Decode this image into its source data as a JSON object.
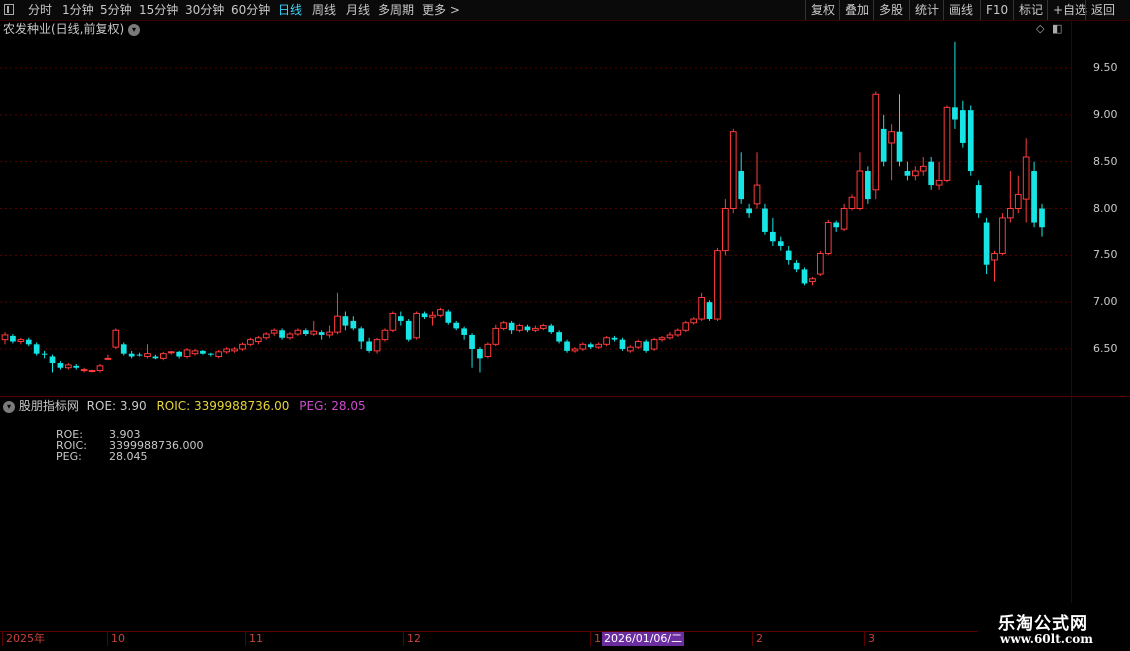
{
  "toolbar": {
    "items": [
      "分时",
      "1分钟",
      "5分钟",
      "15分钟",
      "30分钟",
      "60分钟",
      "日线",
      "周线",
      "月线",
      "多周期",
      "更多 >"
    ],
    "active": "日线",
    "right_items": [
      "复权",
      "叠加",
      "多股",
      "统计",
      "画线",
      "F10",
      "标记",
      "+自选",
      "返回"
    ]
  },
  "stock": {
    "title": "农发种业(日线,前复权)"
  },
  "yaxis": {
    "labels": [
      "9.50",
      "9.00",
      "8.50",
      "8.00",
      "7.50",
      "7.00",
      "6.50"
    ]
  },
  "indicator": {
    "name": "股朋指标网",
    "roe_text": "ROE: 3.90",
    "roic_text": "ROIC: 3399988736.00",
    "peg_text": "PEG: 28.05",
    "rows": [
      {
        "k": "ROE:",
        "v": "3.903"
      },
      {
        "k": "ROIC:",
        "v": "3399988736.000"
      },
      {
        "k": "PEG:",
        "v": "28.045"
      }
    ]
  },
  "dateaxis": {
    "labels": [
      "2025年",
      "10",
      "11",
      "12",
      "1",
      "2",
      "3"
    ],
    "highlight": "2026/01/06/二"
  },
  "watermark": {
    "line1": "乐淘公式网",
    "line2": "www.60lt.com"
  },
  "colors": {
    "up": "#ff3b3b",
    "down": "#17e5e5",
    "grid": "#5a0000",
    "roic": "#e8d63a",
    "peg": "#d04bd0"
  },
  "candles": [
    [
      6.6,
      6.65,
      6.55,
      6.68
    ],
    [
      6.64,
      6.58,
      6.56,
      6.66
    ],
    [
      6.58,
      6.6,
      6.55,
      6.62
    ],
    [
      6.6,
      6.55,
      6.53,
      6.62
    ],
    [
      6.55,
      6.45,
      6.43,
      6.57
    ],
    [
      6.45,
      6.44,
      6.4,
      6.48
    ],
    [
      6.42,
      6.35,
      6.25,
      6.44
    ],
    [
      6.35,
      6.3,
      6.28,
      6.37
    ],
    [
      6.3,
      6.33,
      6.28,
      6.35
    ],
    [
      6.32,
      6.3,
      6.28,
      6.34
    ],
    [
      6.28,
      6.28,
      6.25,
      6.3
    ],
    [
      6.26,
      6.27,
      6.25,
      6.28
    ],
    [
      6.27,
      6.32,
      6.25,
      6.34
    ],
    [
      6.4,
      6.4,
      6.38,
      6.44
    ],
    [
      6.52,
      6.7,
      6.5,
      6.72
    ],
    [
      6.55,
      6.45,
      6.43,
      6.57
    ],
    [
      6.45,
      6.42,
      6.4,
      6.48
    ],
    [
      6.44,
      6.43,
      6.42,
      6.46
    ],
    [
      6.42,
      6.45,
      6.4,
      6.55
    ],
    [
      6.42,
      6.4,
      6.39,
      6.44
    ],
    [
      6.4,
      6.45,
      6.38,
      6.47
    ],
    [
      6.46,
      6.47,
      6.44,
      6.48
    ],
    [
      6.47,
      6.42,
      6.4,
      6.48
    ],
    [
      6.42,
      6.49,
      6.4,
      6.51
    ],
    [
      6.45,
      6.48,
      6.43,
      6.5
    ],
    [
      6.48,
      6.45,
      6.44,
      6.49
    ],
    [
      6.45,
      6.44,
      6.42,
      6.46
    ],
    [
      6.42,
      6.47,
      6.4,
      6.49
    ],
    [
      6.47,
      6.5,
      6.45,
      6.52
    ],
    [
      6.48,
      6.5,
      6.46,
      6.52
    ],
    [
      6.5,
      6.55,
      6.48,
      6.57
    ],
    [
      6.55,
      6.6,
      6.53,
      6.62
    ],
    [
      6.58,
      6.62,
      6.55,
      6.64
    ],
    [
      6.62,
      6.66,
      6.6,
      6.68
    ],
    [
      6.67,
      6.7,
      6.64,
      6.72
    ],
    [
      6.7,
      6.62,
      6.6,
      6.72
    ],
    [
      6.62,
      6.66,
      6.6,
      6.68
    ],
    [
      6.66,
      6.7,
      6.64,
      6.72
    ],
    [
      6.7,
      6.66,
      6.64,
      6.72
    ],
    [
      6.66,
      6.69,
      6.64,
      6.8
    ],
    [
      6.68,
      6.65,
      6.6,
      6.7
    ],
    [
      6.65,
      6.68,
      6.62,
      6.75
    ],
    [
      6.68,
      6.85,
      6.66,
      7.1
    ],
    [
      6.85,
      6.75,
      6.7,
      6.9
    ],
    [
      6.8,
      6.72,
      6.7,
      6.85
    ],
    [
      6.72,
      6.58,
      6.5,
      6.74
    ],
    [
      6.58,
      6.48,
      6.46,
      6.62
    ],
    [
      6.48,
      6.6,
      6.45,
      6.62
    ],
    [
      6.6,
      6.7,
      6.58,
      6.72
    ],
    [
      6.7,
      6.88,
      6.68,
      6.9
    ],
    [
      6.85,
      6.8,
      6.75,
      6.9
    ],
    [
      6.8,
      6.6,
      6.58,
      6.82
    ],
    [
      6.62,
      6.88,
      6.6,
      6.9
    ],
    [
      6.88,
      6.84,
      6.82,
      6.9
    ],
    [
      6.84,
      6.86,
      6.75,
      6.9
    ],
    [
      6.86,
      6.92,
      6.84,
      6.94
    ],
    [
      6.9,
      6.78,
      6.76,
      6.92
    ],
    [
      6.78,
      6.72,
      6.7,
      6.8
    ],
    [
      6.72,
      6.65,
      6.6,
      6.74
    ],
    [
      6.65,
      6.5,
      6.3,
      6.67
    ],
    [
      6.5,
      6.4,
      6.25,
      6.52
    ],
    [
      6.42,
      6.55,
      6.4,
      6.57
    ],
    [
      6.55,
      6.72,
      6.53,
      6.76
    ],
    [
      6.72,
      6.78,
      6.7,
      6.8
    ],
    [
      6.78,
      6.7,
      6.66,
      6.8
    ],
    [
      6.7,
      6.75,
      6.68,
      6.77
    ],
    [
      6.74,
      6.7,
      6.68,
      6.76
    ],
    [
      6.7,
      6.72,
      6.68,
      6.75
    ],
    [
      6.72,
      6.75,
      6.7,
      6.77
    ],
    [
      6.75,
      6.68,
      6.66,
      6.77
    ],
    [
      6.68,
      6.58,
      6.56,
      6.7
    ],
    [
      6.58,
      6.48,
      6.46,
      6.6
    ],
    [
      6.48,
      6.5,
      6.46,
      6.52
    ],
    [
      6.5,
      6.55,
      6.48,
      6.57
    ],
    [
      6.55,
      6.52,
      6.5,
      6.57
    ],
    [
      6.52,
      6.55,
      6.5,
      6.57
    ],
    [
      6.55,
      6.62,
      6.53,
      6.64
    ],
    [
      6.62,
      6.6,
      6.58,
      6.64
    ],
    [
      6.6,
      6.5,
      6.48,
      6.62
    ],
    [
      6.48,
      6.52,
      6.46,
      6.54
    ],
    [
      6.52,
      6.58,
      6.5,
      6.6
    ],
    [
      6.58,
      6.48,
      6.46,
      6.6
    ],
    [
      6.5,
      6.6,
      6.48,
      6.62
    ],
    [
      6.6,
      6.62,
      6.58,
      6.64
    ],
    [
      6.62,
      6.65,
      6.6,
      6.68
    ],
    [
      6.65,
      6.7,
      6.63,
      6.72
    ],
    [
      6.7,
      6.78,
      6.68,
      6.8
    ],
    [
      6.78,
      6.82,
      6.76,
      6.84
    ],
    [
      6.82,
      7.05,
      6.8,
      7.1
    ],
    [
      7.0,
      6.82,
      6.8,
      7.02
    ],
    [
      6.82,
      7.55,
      6.8,
      7.58
    ],
    [
      7.55,
      8.0,
      7.5,
      8.1
    ],
    [
      8.0,
      8.82,
      7.95,
      8.85
    ],
    [
      8.4,
      8.1,
      8.05,
      8.6
    ],
    [
      8.0,
      7.95,
      7.9,
      8.05
    ],
    [
      8.05,
      8.25,
      8.0,
      8.6
    ],
    [
      8.0,
      7.75,
      7.72,
      8.05
    ],
    [
      7.75,
      7.65,
      7.6,
      7.9
    ],
    [
      7.65,
      7.6,
      7.55,
      7.7
    ],
    [
      7.55,
      7.45,
      7.4,
      7.6
    ],
    [
      7.42,
      7.35,
      7.32,
      7.45
    ],
    [
      7.35,
      7.2,
      7.18,
      7.37
    ],
    [
      7.22,
      7.25,
      7.18,
      7.27
    ],
    [
      7.3,
      7.52,
      7.28,
      7.55
    ],
    [
      7.52,
      7.85,
      7.5,
      7.88
    ],
    [
      7.85,
      7.8,
      7.75,
      7.87
    ],
    [
      7.78,
      8.0,
      7.76,
      8.05
    ],
    [
      8.0,
      8.12,
      7.98,
      8.15
    ],
    [
      8.0,
      8.4,
      7.98,
      8.6
    ],
    [
      8.4,
      8.1,
      8.05,
      8.45
    ],
    [
      8.2,
      9.22,
      8.1,
      9.25
    ],
    [
      8.85,
      8.5,
      8.45,
      9.0
    ],
    [
      8.7,
      8.82,
      8.3,
      8.9
    ],
    [
      8.82,
      8.5,
      8.45,
      9.22
    ],
    [
      8.4,
      8.35,
      8.3,
      8.5
    ],
    [
      8.35,
      8.4,
      8.3,
      8.45
    ],
    [
      8.4,
      8.45,
      8.35,
      8.55
    ],
    [
      8.5,
      8.25,
      8.2,
      8.55
    ],
    [
      8.25,
      8.3,
      8.2,
      8.5
    ],
    [
      8.3,
      9.08,
      8.28,
      9.1
    ],
    [
      9.08,
      8.95,
      8.85,
      9.78
    ],
    [
      9.05,
      8.7,
      8.65,
      9.15
    ],
    [
      9.05,
      8.4,
      8.35,
      9.1
    ],
    [
      8.25,
      7.95,
      7.9,
      8.3
    ],
    [
      7.85,
      7.4,
      7.3,
      7.9
    ],
    [
      7.45,
      7.52,
      7.22,
      7.55
    ],
    [
      7.52,
      7.9,
      7.5,
      7.95
    ],
    [
      7.9,
      8.0,
      7.85,
      8.4
    ],
    [
      8.0,
      8.15,
      7.95,
      8.35
    ],
    [
      8.1,
      8.55,
      7.85,
      8.75
    ],
    [
      8.4,
      7.85,
      7.8,
      8.5
    ],
    [
      8.0,
      7.8,
      7.7,
      8.05
    ]
  ]
}
